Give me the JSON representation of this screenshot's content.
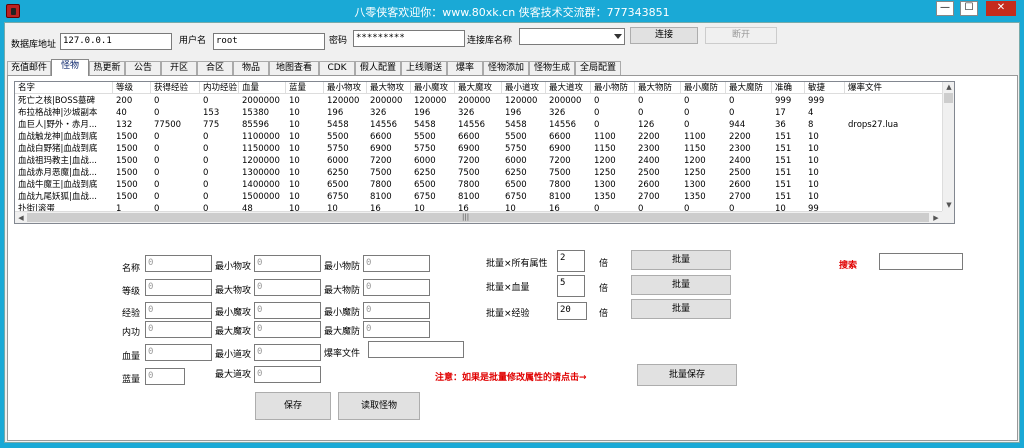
{
  "window": {
    "title": "八零侠客欢迎你：www.80xk.cn  侠客技术交流群：777343851",
    "minimize": "—",
    "maximize": "☐",
    "close": "✕"
  },
  "connection": {
    "db_address_label": "数据库地址",
    "db_address_value": "127.0.0.1",
    "username_label": "用户名",
    "username_value": "root",
    "password_label": "密码",
    "password_value": "*********",
    "dbname_label": "连接库名称",
    "dbname_value": "",
    "connect_label": "连接",
    "disconnect_label": "断开"
  },
  "tabs": [
    "充值邮件",
    "怪物",
    "热更新",
    "公告",
    "开区",
    "合区",
    "物品",
    "地图查看",
    "CDK",
    "假人配置",
    "上线赠送",
    "爆率",
    "怪物添加",
    "怪物生成",
    "全局配置"
  ],
  "active_tab": "怪物",
  "table": {
    "columns": [
      "名字",
      "等级",
      "获得经验",
      "内功经验",
      "血量",
      "蓝量",
      "最小物攻",
      "最大物攻",
      "最小魔攻",
      "最大魔攻",
      "最小道攻",
      "最大道攻",
      "最小物防",
      "最大物防",
      "最小魔防",
      "最大魔防",
      "准确",
      "敏捷",
      "爆率文件"
    ],
    "rows": [
      [
        "死亡之核|BOSS墓碑",
        "200",
        "0",
        "0",
        "2000000",
        "10",
        "120000",
        "200000",
        "120000",
        "200000",
        "120000",
        "200000",
        "0",
        "0",
        "0",
        "0",
        "999",
        "999",
        ""
      ],
      [
        "布拉格战神|沙城副本",
        "40",
        "0",
        "153",
        "15380",
        "10",
        "196",
        "326",
        "196",
        "326",
        "196",
        "326",
        "0",
        "0",
        "0",
        "0",
        "17",
        "4",
        ""
      ],
      [
        "血巨人|野外・赤月...",
        "132",
        "77500",
        "775",
        "85596",
        "10",
        "5458",
        "14556",
        "5458",
        "14556",
        "5458",
        "14556",
        "0",
        "126",
        "0",
        "944",
        "36",
        "8",
        "drops27.lua"
      ],
      [
        "血战触龙神|血战到底",
        "1500",
        "0",
        "0",
        "1100000",
        "10",
        "5500",
        "6600",
        "5500",
        "6600",
        "5500",
        "6600",
        "1100",
        "2200",
        "1100",
        "2200",
        "151",
        "10",
        ""
      ],
      [
        "血战白野猪|血战到底",
        "1500",
        "0",
        "0",
        "1150000",
        "10",
        "5750",
        "6900",
        "5750",
        "6900",
        "5750",
        "6900",
        "1150",
        "2300",
        "1150",
        "2300",
        "151",
        "10",
        ""
      ],
      [
        "血战祖玛教主|血战...",
        "1500",
        "0",
        "0",
        "1200000",
        "10",
        "6000",
        "7200",
        "6000",
        "7200",
        "6000",
        "7200",
        "1200",
        "2400",
        "1200",
        "2400",
        "151",
        "10",
        ""
      ],
      [
        "血战赤月恶魔|血战...",
        "1500",
        "0",
        "0",
        "1300000",
        "10",
        "6250",
        "7500",
        "6250",
        "7500",
        "6250",
        "7500",
        "1250",
        "2500",
        "1250",
        "2500",
        "151",
        "10",
        ""
      ],
      [
        "血战牛魔王|血战到底",
        "1500",
        "0",
        "0",
        "1400000",
        "10",
        "6500",
        "7800",
        "6500",
        "7800",
        "6500",
        "7800",
        "1300",
        "2600",
        "1300",
        "2600",
        "151",
        "10",
        ""
      ],
      [
        "血战九尾妖狐|血战...",
        "1500",
        "0",
        "0",
        "1500000",
        "10",
        "6750",
        "8100",
        "6750",
        "8100",
        "6750",
        "8100",
        "1350",
        "2700",
        "1350",
        "2700",
        "151",
        "10",
        ""
      ],
      [
        "扑街|滚蛋",
        "1",
        "0",
        "0",
        "48",
        "10",
        "10",
        "16",
        "10",
        "16",
        "10",
        "16",
        "0",
        "0",
        "0",
        "0",
        "10",
        "99",
        ""
      ]
    ]
  },
  "form": {
    "name_label": "名称",
    "name_value": "0",
    "level_label": "等级",
    "level_value": "0",
    "exp_label": "经验",
    "exp_value": "0",
    "inner_label": "内功",
    "inner_value": "0",
    "hp_label": "血量",
    "hp_value": "0",
    "mp_label": "蓝量",
    "mp_value": "0",
    "min_patk_label": "最小物攻",
    "min_patk_value": "0",
    "max_patk_label": "最大物攻",
    "max_patk_value": "0",
    "min_matk_label": "最小魔攻",
    "min_matk_value": "0",
    "max_matk_label": "最大魔攻",
    "max_matk_value": "0",
    "min_datk_label": "最小道攻",
    "min_datk_value": "0",
    "max_datk_label": "最大道攻",
    "max_datk_value": "0",
    "min_pdef_label": "最小物防",
    "min_pdef_value": "0",
    "max_pdef_label": "最大物防",
    "max_pdef_value": "0",
    "min_mdef_label": "最小魔防",
    "min_mdef_value": "0",
    "max_mdef_label": "最大魔防",
    "max_mdef_value": "0",
    "drop_file_label": "爆率文件",
    "drop_file_value": "",
    "save_label": "保存",
    "read_label": "读取怪物"
  },
  "batch": {
    "all_label": "批量×所有属性",
    "all_value": "2",
    "hp_label": "批量×血量",
    "hp_value": "5",
    "exp_label": "批量×经验",
    "exp_value": "20",
    "times": "倍",
    "batch_button": "批量",
    "notice": "注意：如果是批量修改属性的请点击→",
    "batch_save": "批量保存",
    "search_label": "搜索",
    "search_value": ""
  },
  "colors": {
    "titlebar": "#1aa9d6",
    "close": "#c42b1c",
    "warning": "#e00000"
  }
}
